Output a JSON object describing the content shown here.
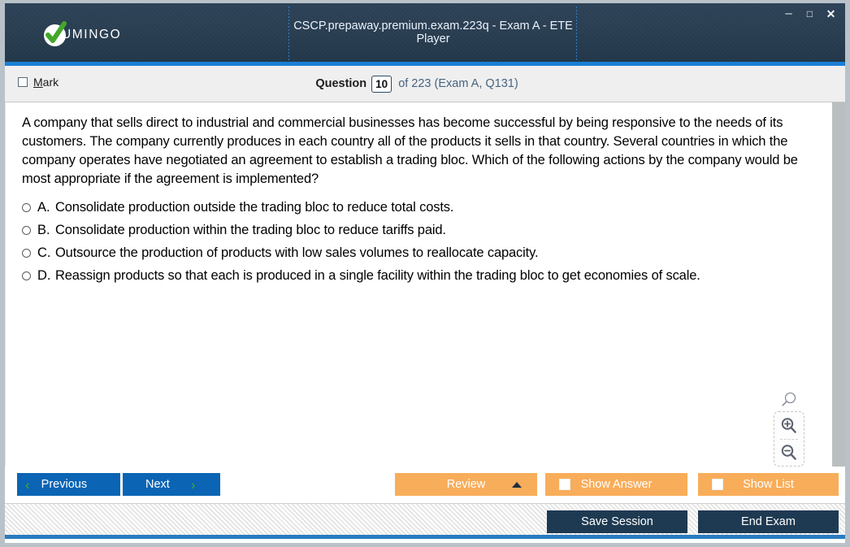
{
  "window": {
    "title": "CSCP.prepaway.premium.exam.223q - Exam A - ETE Player",
    "brand": "UMINGO",
    "controls": {
      "minimize": "–",
      "maximize": "□",
      "close": "✕"
    },
    "accent_blue": "#1a7fd4",
    "titlebar_bg": "#2b3f53"
  },
  "question_header": {
    "mark_label_accel": "M",
    "mark_label_rest": "ark",
    "mark_checked": false,
    "question_word": "Question",
    "question_number": "10",
    "of_text": "of 223 (Exam A, Q131)"
  },
  "question": {
    "text": "A company that sells direct to industrial and commercial businesses has become successful by being responsive to the needs of its customers. The company currently produces in each country all of the products it sells in that country. Several countries in which the company operates have negotiated an agreement to establish a trading bloc. Which of the following actions by the company would be most appropriate if the agreement is implemented?",
    "options": [
      {
        "letter": "A.",
        "text": "Consolidate production outside the trading bloc to reduce total costs.",
        "selected": false
      },
      {
        "letter": "B.",
        "text": "Consolidate production within the trading bloc to reduce tariffs paid.",
        "selected": false
      },
      {
        "letter": "C.",
        "text": "Outsource the production of products with low sales volumes to reallocate capacity.",
        "selected": false
      },
      {
        "letter": "D.",
        "text": "Reassign products so that each is produced in a single facility within the trading bloc to get economies of scale.",
        "selected": false
      }
    ]
  },
  "tools": {
    "magnifier": "magnifier-icon",
    "zoom_in": "zoom-in-icon",
    "zoom_out": "zoom-out-icon"
  },
  "action_bar": {
    "previous": "Previous",
    "next": "Next",
    "review": "Review",
    "show_answer": "Show Answer",
    "show_list": "Show List",
    "chevron_left": "‹",
    "chevron_right": "›",
    "accent_orange": "#f8ad5a",
    "accent_blue": "#0b64b4",
    "chevron_green": "#4aa832"
  },
  "status_bar": {
    "save_session": "Save Session",
    "end_exam": "End Exam",
    "button_bg": "#1e3a52"
  }
}
